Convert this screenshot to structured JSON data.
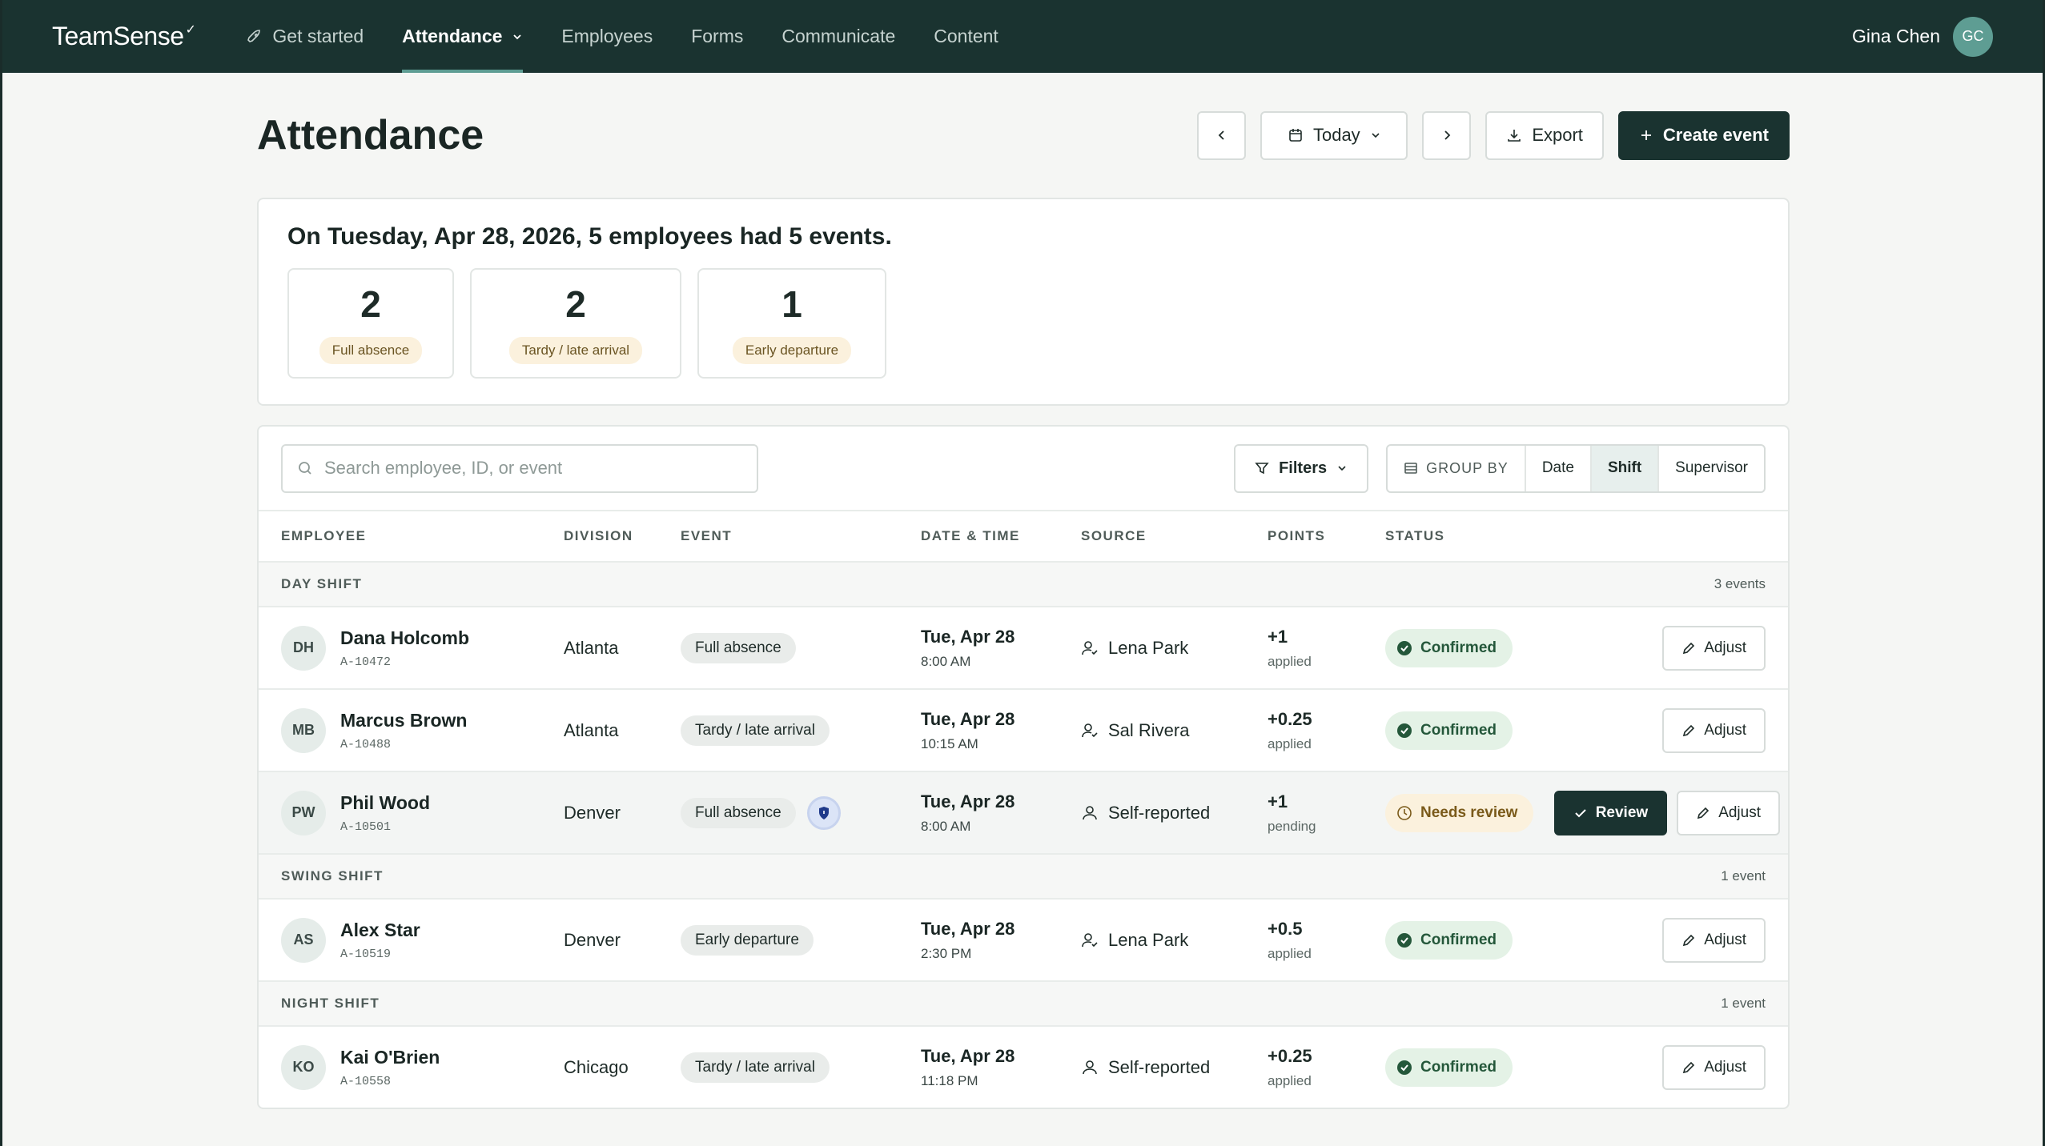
{
  "app": {
    "logo": "TeamSense",
    "nav": [
      {
        "label": "Get started",
        "icon": "rocket-icon"
      },
      {
        "label": "Attendance",
        "icon": "chevron-down-icon",
        "active": true
      },
      {
        "label": "Employees"
      },
      {
        "label": "Forms"
      },
      {
        "label": "Communicate"
      },
      {
        "label": "Content"
      }
    ],
    "user": {
      "name": "Gina Chen",
      "initials": "GC"
    }
  },
  "page": {
    "title": "Attendance",
    "date_selector": "Today",
    "export_label": "Export",
    "create_label": "Create event"
  },
  "summary": {
    "text": "On Tuesday, Apr 28, 2026, 5 employees had 5 events.",
    "stats": [
      {
        "value": "2",
        "label": "Full absence"
      },
      {
        "value": "2",
        "label": "Tardy / late arrival"
      },
      {
        "value": "1",
        "label": "Early departure"
      }
    ]
  },
  "toolbar": {
    "search_placeholder": "Search employee, ID, or event",
    "filters_label": "Filters",
    "group_by_label": "GROUP BY",
    "group_options": [
      "Date",
      "Shift",
      "Supervisor"
    ],
    "group_selected": "Shift"
  },
  "columns": [
    "EMPLOYEE",
    "DIVISION",
    "EVENT",
    "DATE & TIME",
    "SOURCE",
    "POINTS",
    "STATUS"
  ],
  "groups": [
    {
      "name": "DAY SHIFT",
      "count": "3 events",
      "rows": [
        {
          "initials": "DH",
          "name": "Dana Holcomb",
          "id": "A-10472",
          "division": "Atlanta",
          "event": "Full absence",
          "date": "Tue, Apr 28",
          "time": "8:00 AM",
          "source": "Lena Park",
          "points": "+1",
          "points_note": "applied",
          "status": "Confirmed"
        },
        {
          "initials": "MB",
          "name": "Marcus Brown",
          "id": "A-10488",
          "division": "Atlanta",
          "event": "Tardy / late arrival",
          "date": "Tue, Apr 28",
          "time": "10:15 AM",
          "source": "Sal Rivera",
          "points": "+0.25",
          "points_note": "applied",
          "status": "Confirmed"
        },
        {
          "initials": "PW",
          "name": "Phil Wood",
          "id": "A-10501",
          "division": "Denver",
          "event": "Full absence",
          "date": "Tue, Apr 28",
          "time": "8:00 AM",
          "source": "Self-reported",
          "points": "+1",
          "points_note": "pending",
          "status": "Needs review",
          "review_label": "Review"
        }
      ]
    },
    {
      "name": "SWING SHIFT",
      "count": "1 event",
      "rows": [
        {
          "initials": "AS",
          "name": "Alex Star",
          "id": "A-10519",
          "division": "Denver",
          "event": "Early departure",
          "date": "Tue, Apr 28",
          "time": "2:30 PM",
          "source": "Lena Park",
          "points": "+0.5",
          "points_note": "applied",
          "status": "Confirmed"
        }
      ]
    },
    {
      "name": "NIGHT SHIFT",
      "count": "1 event",
      "rows": [
        {
          "initials": "KO",
          "name": "Kai O'Brien",
          "id": "A-10558",
          "division": "Chicago",
          "event": "Tardy / late arrival",
          "date": "Tue, Apr 28",
          "time": "11:18 PM",
          "source": "Self-reported",
          "points": "+0.25",
          "points_note": "applied",
          "status": "Confirmed"
        }
      ]
    }
  ],
  "adjust_label": "Adjust",
  "colors": {
    "nav_bg": "#1a3330",
    "accent": "#5e9d93",
    "confirmed_bg": "#e4f2e6",
    "warn_bg": "#fbf1dd"
  }
}
